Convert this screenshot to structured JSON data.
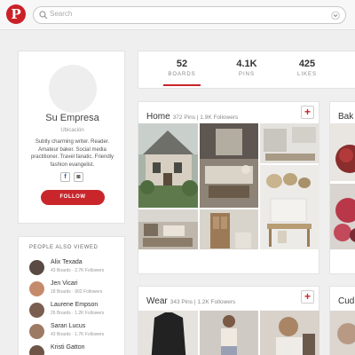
{
  "brand": {
    "logo_letter": "P",
    "accent": "#cb2027"
  },
  "search": {
    "placeholder": "Search",
    "icon": "search-icon"
  },
  "profile": {
    "name": "Su Empresa",
    "location": "Ubicación",
    "bio": "Subtly charming writer. Reader. Amateur baker. Social media practitioner. Travel fanatic. Friendly fashion evangelist.",
    "social": [
      {
        "icon": "facebook-icon",
        "glyph": "f"
      },
      {
        "icon": "instagram-icon",
        "glyph": "◙"
      }
    ],
    "follow_label": "FOLLOW"
  },
  "people_also_viewed": {
    "title": "PEOPLE ALSO VIEWED",
    "people": [
      {
        "name": "Alix Texada",
        "meta": "43 Boards  ·  2.7K Followers"
      },
      {
        "name": "Jen Vicari",
        "meta": "18 Boards  ·  902 Followers"
      },
      {
        "name": "Laurene Empson",
        "meta": "26 Boards  ·  1.2K Followers"
      },
      {
        "name": "Saran Lucus",
        "meta": "43 Boards  ·  1.7K Followers"
      },
      {
        "name": "Kristi Gatton",
        "meta": ""
      }
    ]
  },
  "stats": [
    {
      "value": "52",
      "label": "BOARDS"
    },
    {
      "value": "4.1K",
      "label": "PINS"
    },
    {
      "value": "425",
      "label": "LIKES"
    }
  ],
  "boards": [
    {
      "name": "Home",
      "meta": "372 Pins  |  1.9K Followers",
      "add": "+"
    },
    {
      "name": "Bak",
      "meta": "",
      "add": ""
    },
    {
      "name": "Wear",
      "meta": "343 Pins  |  1.2K Followers",
      "add": "+"
    },
    {
      "name": "Cud",
      "meta": "",
      "add": ""
    }
  ]
}
